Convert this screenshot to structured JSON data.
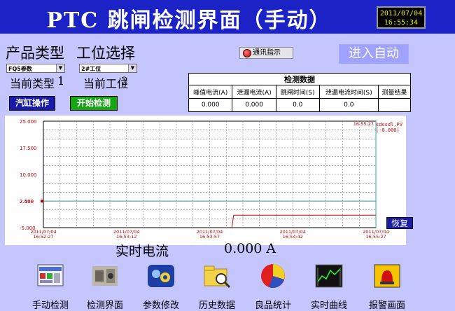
{
  "title": "PTC  跳闸检测界面（手动）",
  "clock": {
    "date": "2011/07/04",
    "time": "16:55:34"
  },
  "product": {
    "label": "产品类型",
    "select_value": "FQ5参数",
    "current_label": "当前类型",
    "current_value": "1"
  },
  "station": {
    "label": "工位选择",
    "select_value": "2#工位",
    "current_label": "当前工位",
    "current_value": "2"
  },
  "comm_indicator": "通讯指示",
  "auto_button": "进入自动",
  "buttons": {
    "cylinder": "汽缸操作",
    "start": "开始检测"
  },
  "data_table": {
    "caption": "检测数据",
    "headers": [
      "峰值电流(A)",
      "泄漏电流(A)",
      "跳闸时间(S)",
      "泄漏电流时间(S)",
      "测量结果"
    ],
    "row": [
      "0.000",
      "0.000",
      "0.0",
      "0.0",
      ""
    ]
  },
  "chart_data": {
    "type": "line",
    "y_ticks": [
      "25.000",
      "17.500",
      "10.000",
      "2.500",
      "2.469",
      "-5.000"
    ],
    "ylim": [
      -5,
      25
    ],
    "x_ticks": [
      {
        "date": "2011/07/04",
        "time": "16:52:27"
      },
      {
        "date": "2011/07/04",
        "time": "16:53:12"
      },
      {
        "date": "2011/07/04",
        "time": "16:53:57"
      },
      {
        "date": "2011/07/04",
        "time": "16:54:42"
      },
      {
        "date": "2011/07/04",
        "time": "16:55:27"
      }
    ],
    "cursor_time": "16:55:27",
    "legend": [
      "sdssdl.PV",
      "[-0.000]"
    ],
    "reference_line": {
      "value": 2.469,
      "color": "#2ea0a0"
    },
    "series": [
      {
        "name": "sdssdl.PV",
        "color": "#e00000",
        "points": [
          [
            "16:54:09",
            -5.0
          ],
          [
            "16:54:10",
            -1.5
          ],
          [
            "16:55:27",
            -1.5
          ]
        ]
      }
    ],
    "grid": true
  },
  "restore_button": "恢复",
  "realtime": {
    "label": "实时电流",
    "value": "0.000 A"
  },
  "nav": [
    {
      "label": "手动检测",
      "icon": "manual-test-icon"
    },
    {
      "label": "检测界面",
      "icon": "inspection-icon"
    },
    {
      "label": "参数修改",
      "icon": "parameter-icon"
    },
    {
      "label": "历史数据",
      "icon": "history-icon"
    },
    {
      "label": "良品统计",
      "icon": "statistics-pie-icon"
    },
    {
      "label": "实时曲线",
      "icon": "realtime-curve-icon"
    },
    {
      "label": "报警画面",
      "icon": "alarm-icon"
    }
  ],
  "colors": {
    "title_bar": "#1c23c6",
    "background": "#c6c6ff",
    "clock_text": "#e8e800",
    "trend_line": "#e00000"
  }
}
